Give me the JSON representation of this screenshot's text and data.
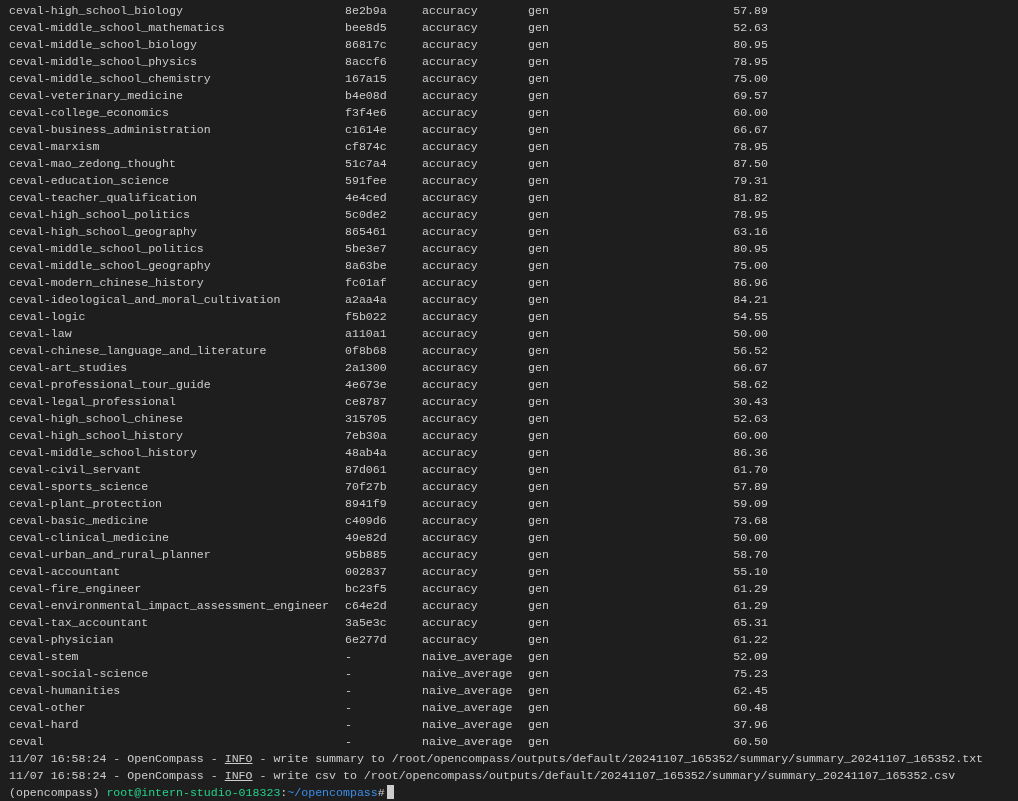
{
  "rows": [
    {
      "dataset": "ceval-high_school_biology",
      "version": "8e2b9a",
      "metric": "accuracy",
      "mode": "gen",
      "value": "57.89"
    },
    {
      "dataset": "ceval-middle_school_mathematics",
      "version": "bee8d5",
      "metric": "accuracy",
      "mode": "gen",
      "value": "52.63"
    },
    {
      "dataset": "ceval-middle_school_biology",
      "version": "86817c",
      "metric": "accuracy",
      "mode": "gen",
      "value": "80.95"
    },
    {
      "dataset": "ceval-middle_school_physics",
      "version": "8accf6",
      "metric": "accuracy",
      "mode": "gen",
      "value": "78.95"
    },
    {
      "dataset": "ceval-middle_school_chemistry",
      "version": "167a15",
      "metric": "accuracy",
      "mode": "gen",
      "value": "75.00"
    },
    {
      "dataset": "ceval-veterinary_medicine",
      "version": "b4e08d",
      "metric": "accuracy",
      "mode": "gen",
      "value": "69.57"
    },
    {
      "dataset": "ceval-college_economics",
      "version": "f3f4e6",
      "metric": "accuracy",
      "mode": "gen",
      "value": "60.00"
    },
    {
      "dataset": "ceval-business_administration",
      "version": "c1614e",
      "metric": "accuracy",
      "mode": "gen",
      "value": "66.67"
    },
    {
      "dataset": "ceval-marxism",
      "version": "cf874c",
      "metric": "accuracy",
      "mode": "gen",
      "value": "78.95"
    },
    {
      "dataset": "ceval-mao_zedong_thought",
      "version": "51c7a4",
      "metric": "accuracy",
      "mode": "gen",
      "value": "87.50"
    },
    {
      "dataset": "ceval-education_science",
      "version": "591fee",
      "metric": "accuracy",
      "mode": "gen",
      "value": "79.31"
    },
    {
      "dataset": "ceval-teacher_qualification",
      "version": "4e4ced",
      "metric": "accuracy",
      "mode": "gen",
      "value": "81.82"
    },
    {
      "dataset": "ceval-high_school_politics",
      "version": "5c0de2",
      "metric": "accuracy",
      "mode": "gen",
      "value": "78.95"
    },
    {
      "dataset": "ceval-high_school_geography",
      "version": "865461",
      "metric": "accuracy",
      "mode": "gen",
      "value": "63.16"
    },
    {
      "dataset": "ceval-middle_school_politics",
      "version": "5be3e7",
      "metric": "accuracy",
      "mode": "gen",
      "value": "80.95"
    },
    {
      "dataset": "ceval-middle_school_geography",
      "version": "8a63be",
      "metric": "accuracy",
      "mode": "gen",
      "value": "75.00"
    },
    {
      "dataset": "ceval-modern_chinese_history",
      "version": "fc01af",
      "metric": "accuracy",
      "mode": "gen",
      "value": "86.96"
    },
    {
      "dataset": "ceval-ideological_and_moral_cultivation",
      "version": "a2aa4a",
      "metric": "accuracy",
      "mode": "gen",
      "value": "84.21"
    },
    {
      "dataset": "ceval-logic",
      "version": "f5b022",
      "metric": "accuracy",
      "mode": "gen",
      "value": "54.55"
    },
    {
      "dataset": "ceval-law",
      "version": "a110a1",
      "metric": "accuracy",
      "mode": "gen",
      "value": "50.00"
    },
    {
      "dataset": "ceval-chinese_language_and_literature",
      "version": "0f8b68",
      "metric": "accuracy",
      "mode": "gen",
      "value": "56.52"
    },
    {
      "dataset": "ceval-art_studies",
      "version": "2a1300",
      "metric": "accuracy",
      "mode": "gen",
      "value": "66.67"
    },
    {
      "dataset": "ceval-professional_tour_guide",
      "version": "4e673e",
      "metric": "accuracy",
      "mode": "gen",
      "value": "58.62"
    },
    {
      "dataset": "ceval-legal_professional",
      "version": "ce8787",
      "metric": "accuracy",
      "mode": "gen",
      "value": "30.43"
    },
    {
      "dataset": "ceval-high_school_chinese",
      "version": "315705",
      "metric": "accuracy",
      "mode": "gen",
      "value": "52.63"
    },
    {
      "dataset": "ceval-high_school_history",
      "version": "7eb30a",
      "metric": "accuracy",
      "mode": "gen",
      "value": "60.00"
    },
    {
      "dataset": "ceval-middle_school_history",
      "version": "48ab4a",
      "metric": "accuracy",
      "mode": "gen",
      "value": "86.36"
    },
    {
      "dataset": "ceval-civil_servant",
      "version": "87d061",
      "metric": "accuracy",
      "mode": "gen",
      "value": "61.70"
    },
    {
      "dataset": "ceval-sports_science",
      "version": "70f27b",
      "metric": "accuracy",
      "mode": "gen",
      "value": "57.89"
    },
    {
      "dataset": "ceval-plant_protection",
      "version": "8941f9",
      "metric": "accuracy",
      "mode": "gen",
      "value": "59.09"
    },
    {
      "dataset": "ceval-basic_medicine",
      "version": "c409d6",
      "metric": "accuracy",
      "mode": "gen",
      "value": "73.68"
    },
    {
      "dataset": "ceval-clinical_medicine",
      "version": "49e82d",
      "metric": "accuracy",
      "mode": "gen",
      "value": "50.00"
    },
    {
      "dataset": "ceval-urban_and_rural_planner",
      "version": "95b885",
      "metric": "accuracy",
      "mode": "gen",
      "value": "58.70"
    },
    {
      "dataset": "ceval-accountant",
      "version": "002837",
      "metric": "accuracy",
      "mode": "gen",
      "value": "55.10"
    },
    {
      "dataset": "ceval-fire_engineer",
      "version": "bc23f5",
      "metric": "accuracy",
      "mode": "gen",
      "value": "61.29"
    },
    {
      "dataset": "ceval-environmental_impact_assessment_engineer",
      "version": "c64e2d",
      "metric": "accuracy",
      "mode": "gen",
      "value": "61.29"
    },
    {
      "dataset": "ceval-tax_accountant",
      "version": "3a5e3c",
      "metric": "accuracy",
      "mode": "gen",
      "value": "65.31"
    },
    {
      "dataset": "ceval-physician",
      "version": "6e277d",
      "metric": "accuracy",
      "mode": "gen",
      "value": "61.22"
    },
    {
      "dataset": "ceval-stem",
      "version": "-",
      "metric": "naive_average",
      "mode": "gen",
      "value": "52.09"
    },
    {
      "dataset": "ceval-social-science",
      "version": "-",
      "metric": "naive_average",
      "mode": "gen",
      "value": "75.23"
    },
    {
      "dataset": "ceval-humanities",
      "version": "-",
      "metric": "naive_average",
      "mode": "gen",
      "value": "62.45"
    },
    {
      "dataset": "ceval-other",
      "version": "-",
      "metric": "naive_average",
      "mode": "gen",
      "value": "60.48"
    },
    {
      "dataset": "ceval-hard",
      "version": "-",
      "metric": "naive_average",
      "mode": "gen",
      "value": "37.96"
    },
    {
      "dataset": "ceval",
      "version": "-",
      "metric": "naive_average",
      "mode": "gen",
      "value": "60.50"
    }
  ],
  "log_lines": [
    {
      "prefix": "11/07 16:58:24 - OpenCompass - ",
      "level": "INFO",
      "message": " - write summary to /root/opencompass/outputs/default/20241107_165352/summary/summary_20241107_165352.txt"
    },
    {
      "prefix": "11/07 16:58:24 - OpenCompass - ",
      "level": "INFO",
      "message": " - write csv to /root/opencompass/outputs/default/20241107_165352/summary/summary_20241107_165352.csv"
    }
  ],
  "prompt": {
    "env": "(opencompass) ",
    "user_host": "root@intern-studio-018323",
    "separator": ":",
    "path": "~/opencompass",
    "symbol": "#"
  }
}
